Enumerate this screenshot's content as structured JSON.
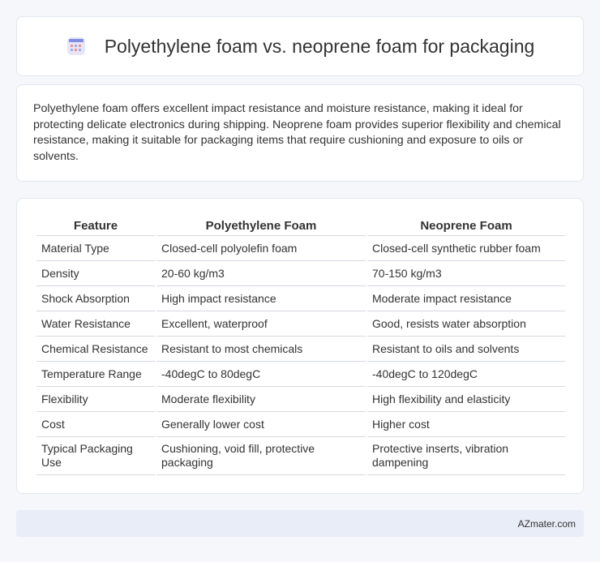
{
  "header": {
    "title": "Polyethylene foam vs. neoprene foam for packaging",
    "icon": "calendar-icon"
  },
  "intro": {
    "text": "Polyethylene foam offers excellent impact resistance and moisture resistance, making it ideal for protecting delicate electronics during shipping. Neoprene foam provides superior flexibility and chemical resistance, making it suitable for packaging items that require cushioning and exposure to oils or solvents."
  },
  "table": {
    "headers": [
      "Feature",
      "Polyethylene Foam",
      "Neoprene Foam"
    ],
    "rows": [
      [
        "Material Type",
        "Closed-cell polyolefin foam",
        "Closed-cell synthetic rubber foam"
      ],
      [
        "Density",
        "20-60 kg/m3",
        "70-150 kg/m3"
      ],
      [
        "Shock Absorption",
        "High impact resistance",
        "Moderate impact resistance"
      ],
      [
        "Water Resistance",
        "Excellent, waterproof",
        "Good, resists water absorption"
      ],
      [
        "Chemical Resistance",
        "Resistant to most chemicals",
        "Resistant to oils and solvents"
      ],
      [
        "Temperature Range",
        "-40degC to 80degC",
        "-40degC to 120degC"
      ],
      [
        "Flexibility",
        "Moderate flexibility",
        "High flexibility and elasticity"
      ],
      [
        "Cost",
        "Generally lower cost",
        "Higher cost"
      ],
      [
        "Typical Packaging Use",
        "Cushioning, void fill, protective packaging",
        "Protective inserts, vibration dampening"
      ]
    ]
  },
  "footer": {
    "brand": "AZmater.com"
  }
}
